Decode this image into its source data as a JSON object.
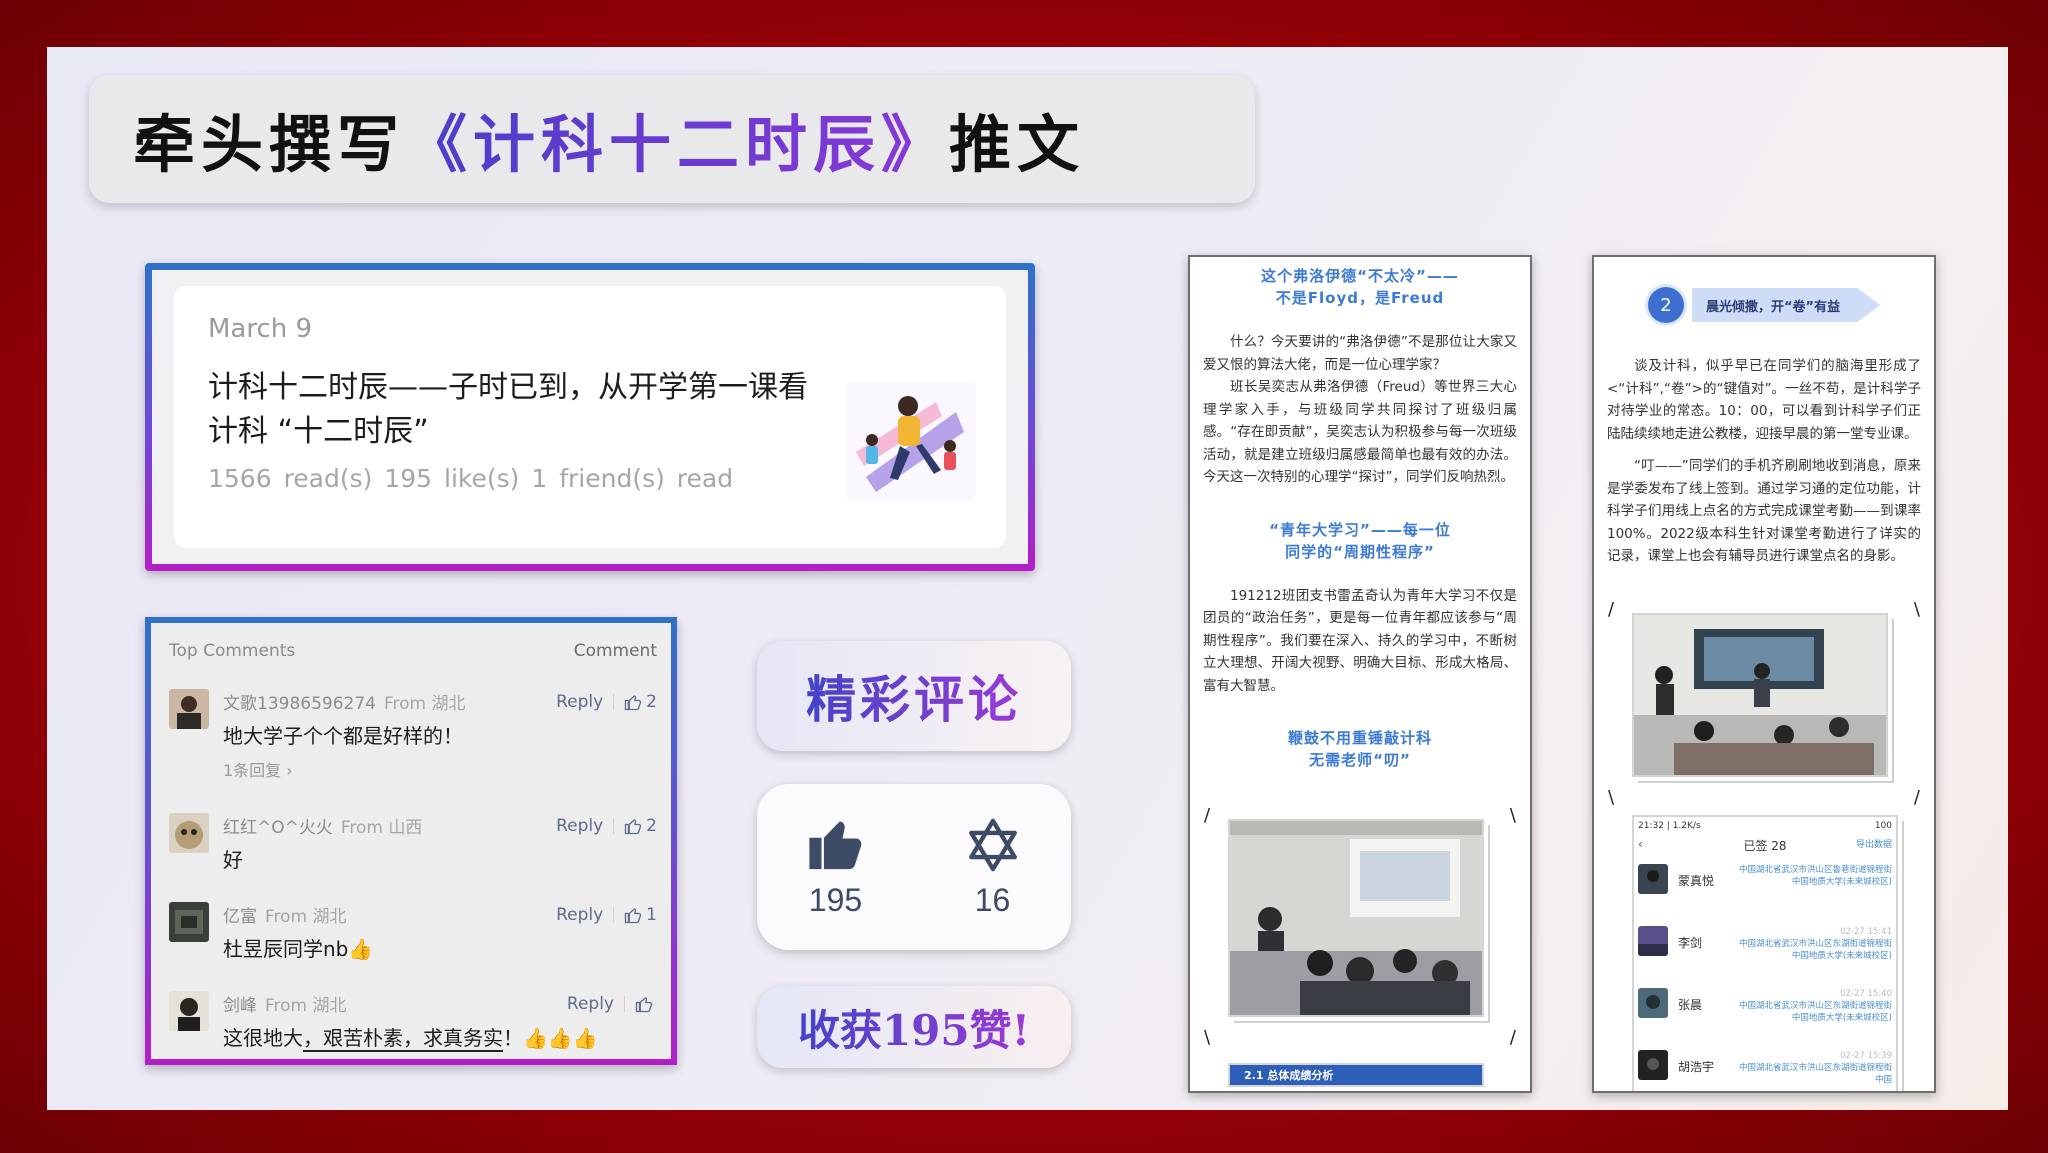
{
  "slide": {
    "title_pre": "牵头撰写",
    "title_hl": "《计科十二时辰》",
    "title_post": "推文"
  },
  "article": {
    "date": "March 9",
    "title": "计科十二时辰——子时已到，从开学第一课看计科 “十二时辰”",
    "stats": "1566 read(s)   195 like(s)   1 friend(s) read"
  },
  "comments": {
    "header": "Top Comments",
    "action": "Comment",
    "items": [
      {
        "name": "文歌13986596274",
        "from": "From 湖北",
        "reply": "Reply",
        "likes": "2",
        "text": "地大学子个个都是好样的！",
        "sub": "1条回复 ›"
      },
      {
        "name": "红红^O^火火",
        "from": "From 山西",
        "reply": "Reply",
        "likes": "2",
        "text": "好",
        "sub": ""
      },
      {
        "name": "亿富",
        "from": "From 湖北",
        "reply": "Reply",
        "likes": "1",
        "text": "杜昱辰同学nb👍",
        "sub": ""
      },
      {
        "name": "剑峰",
        "from": "From 湖北",
        "reply": "Reply",
        "likes": "",
        "text_a": "这很地大",
        "text_b": "，艰苦朴素，求真务实",
        "text_c": "！👍👍👍",
        "sub": ""
      }
    ]
  },
  "badges": {
    "comments_label": "精彩评论",
    "likes_count": "195",
    "favorites_count": "16",
    "likes_label": "收获195赞!"
  },
  "phone_a": {
    "head1_l1": "这个弗洛伊德“不太冷”——",
    "head1_l2": "不是Floyd，是Freud",
    "para1": "什么？今天要讲的“弗洛伊德”不是那位让大家又爱又恨的算法大佬，而是一位心理学家？",
    "para2": "班长吴奕志从弗洛伊德（Freud）等世界三大心理学家入手，与班级同学共同探讨了班级归属感。“存在即贡献”，吴奕志认为积极参与每一次班级活动，就是建立班级归属感最简单也最有效的办法。今天这一次特别的心理学“探讨”，同学们反响热烈。",
    "head2_l1": "“青年大学习”——每一位",
    "head2_l2": "同学的“周期性程序”",
    "para3": "191212班团支书雷孟奇认为青年大学习不仅是团员的“政治任务”，更是每一位青年都应该参与“周期性程序”。我们要在深入、持久的学习中，不断树立大理想、开阔大视野、明确大目标、形成大格局、富有大智慧。",
    "head3_l1": "鞭鼓不用重锤敲计科",
    "head3_l2": "无需老师“叨”",
    "footer_bar": "2.1 总体成绩分析"
  },
  "phone_b": {
    "section_num": "2",
    "section_label": "晨光倾撒，开“卷”有益",
    "para1": "谈及计科，似乎早已在同学们的脑海里形成了<“计科”,“卷”>的“键值对”。一丝不苟，是计科学子对待学业的常态。10：00，可以看到计科学子们正陆陆续续地走进公教楼，迎接早晨的第一堂专业课。",
    "para2": "“叮——”同学们的手机齐刷刷地收到消息，原来是学委发布了线上签到。通过学习通的定位功能，计科学子们用线上点名的方式完成课堂考勤——到课率100%。2022级本科生针对课堂考勤进行了详实的记录，课堂上也会有辅导员进行课堂点名的身影。",
    "att_status": "21:32 | 1.2K/s",
    "att_battery": "100",
    "att_title": "已签 28",
    "att_export": "导出数据",
    "rows": [
      {
        "name": "蒙真悦",
        "time": "",
        "loc": "中国湖北省武汉市洪山区鲁巷街道锦程街中国地质大学(未来城校区)"
      },
      {
        "name": "李剑",
        "time": "02-27 15:41",
        "loc": "中国湖北省武汉市洪山区东湖街道锦程街中国地质大学(未来城校区)"
      },
      {
        "name": "张晨",
        "time": "02-27 15:40",
        "loc": "中国湖北省武汉市洪山区东湖街道锦程街中国地质大学(未来城校区)"
      },
      {
        "name": "胡浩宇",
        "time": "02-27 15:39",
        "loc": "中国湖北省武汉市洪山区东湖街道锦程街中国"
      }
    ]
  },
  "colors": {
    "frame_red": "#b80008",
    "accent_blue": "#3d7bd4",
    "accent_purple": "#8a38d6"
  }
}
